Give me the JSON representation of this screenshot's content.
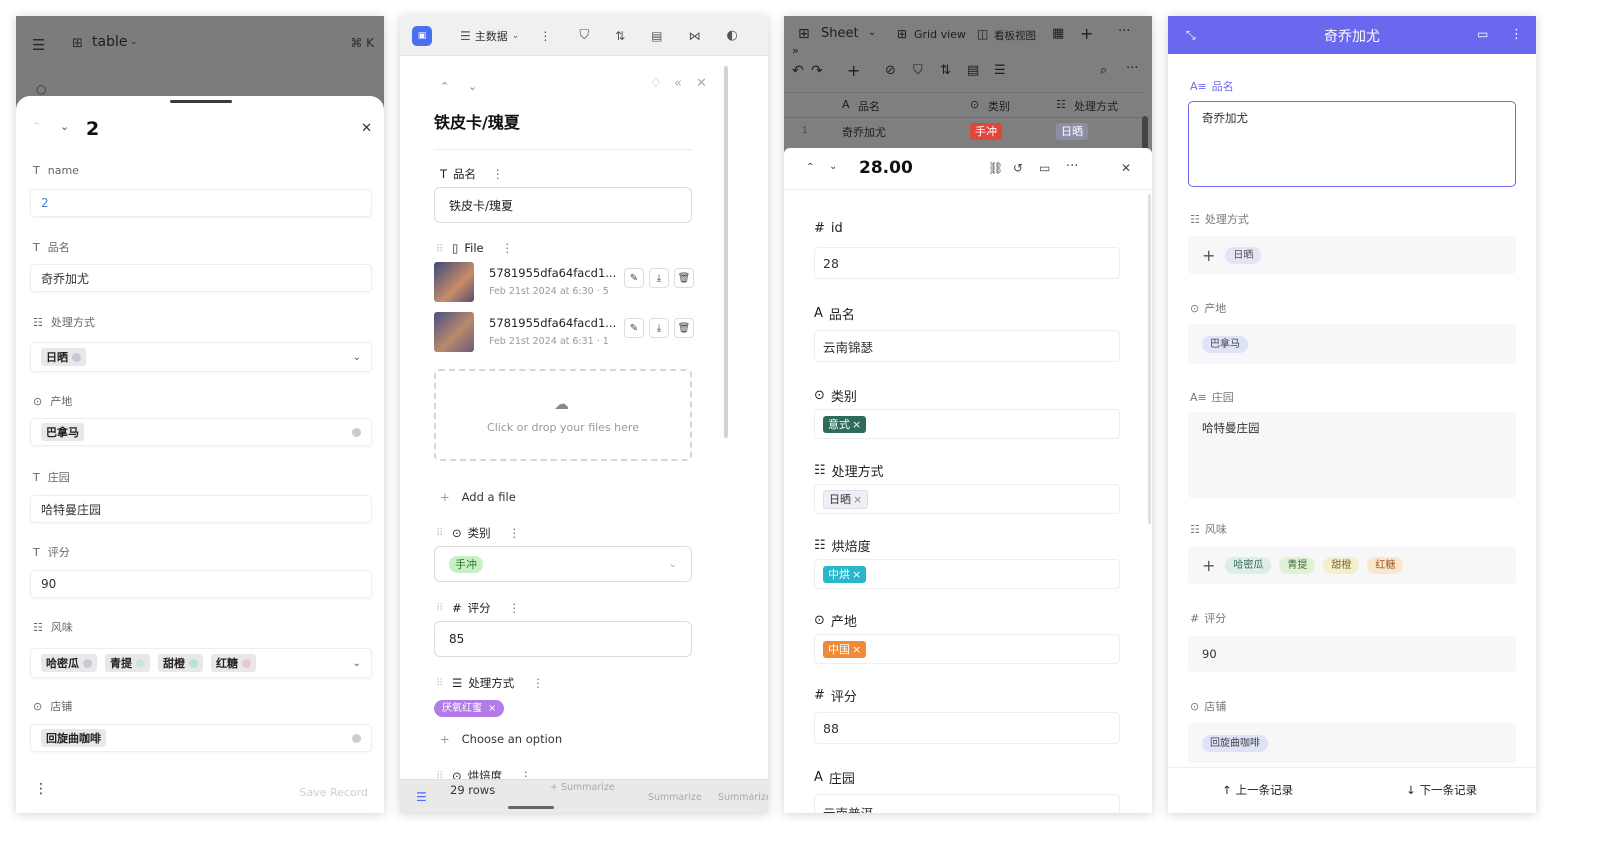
{
  "p1": {
    "breadcrumb": "table",
    "shortcut": "⌘ K",
    "record_no": "2",
    "fields": [
      {
        "label": "name",
        "value": "2"
      },
      {
        "label": "品名",
        "value": "奇乔加尤"
      },
      {
        "label": "处理方式",
        "tag": "日晒"
      },
      {
        "label": "产地",
        "tag": "巴拿马"
      },
      {
        "label": "庄园",
        "value": "哈特曼庄园"
      },
      {
        "label": "评分",
        "value": "90"
      },
      {
        "label": "风味",
        "tags": [
          "哈密瓜",
          "青提",
          "甜橙",
          "红糖"
        ]
      },
      {
        "label": "店铺",
        "tag": "回旋曲咖啡"
      }
    ],
    "save_label": "Save Record"
  },
  "p2": {
    "view_name": "主数据",
    "title": "铁皮卡/瑰夏",
    "f_name_label": "品名",
    "f_name_value": "铁皮卡/瑰夏",
    "f_file_label": "File",
    "files": [
      {
        "name": "5781955dfa64facd1...",
        "date": "Feb 21st 2024 at 6:30 · 5"
      },
      {
        "name": "5781955dfa64facd1...",
        "date": "Feb 21st 2024 at 6:31 · 1"
      }
    ],
    "drop_text": "Click or drop your files here",
    "add_file": "Add a file",
    "f_cat_label": "类别",
    "f_cat_tag": "手冲",
    "f_score_label": "评分",
    "f_score_value": "85",
    "f_proc_label": "处理方式",
    "f_proc_tag": "厌氧红蜜",
    "choose_option": "Choose an option",
    "f_roast_label": "烘焙度",
    "rows": "29 rows",
    "summarize": "Summarize"
  },
  "p3": {
    "sheet": "Sheet",
    "grid_view": "Grid view",
    "kanban": "看板视图",
    "col_name": "品名",
    "col_cat": "类别",
    "col_proc": "处理方式",
    "row_no": "1",
    "row_name": "奇乔加尤",
    "row_cat": "手冲",
    "row_proc": "日晒",
    "record_title": "28.00",
    "f_id_label": "id",
    "f_id_value": "28",
    "f_name_label": "品名",
    "f_name_value": "云南锦瑟",
    "f_cat_label": "类别",
    "f_cat_tag": "意式",
    "f_proc_label": "处理方式",
    "f_proc_tag": "日晒",
    "f_roast_label": "烘焙度",
    "f_roast_tag": "中烘",
    "f_origin_label": "产地",
    "f_origin_tag": "中国",
    "f_score_label": "评分",
    "f_score_value": "88",
    "f_estate_label": "庄园",
    "f_estate_value": "云南普洱"
  },
  "p4": {
    "title": "奇乔加尤",
    "f_name_label": "品名",
    "f_name_value": "奇乔加尤",
    "f_proc_label": "处理方式",
    "f_proc_tag": "日晒",
    "f_origin_label": "产地",
    "f_origin_tag": "巴拿马",
    "f_estate_label": "庄园",
    "f_estate_value": "哈特曼庄园",
    "f_flavor_label": "风味",
    "flavors": [
      "哈密瓜",
      "青提",
      "甜橙",
      "红糖"
    ],
    "f_score_label": "评分",
    "f_score_value": "90",
    "f_shop_label": "店铺",
    "f_shop_tag": "回旋曲咖啡",
    "prev": "上一条记录",
    "next": "下一条记录"
  },
  "colors": {
    "accent_purple": "#6b68f0",
    "tag_red": "#e0463a",
    "tag_green_dark": "#2e6b5a",
    "tag_cyan": "#29b8c9",
    "tag_orange": "#f08a35",
    "tag_purple": "#b27ce8"
  }
}
